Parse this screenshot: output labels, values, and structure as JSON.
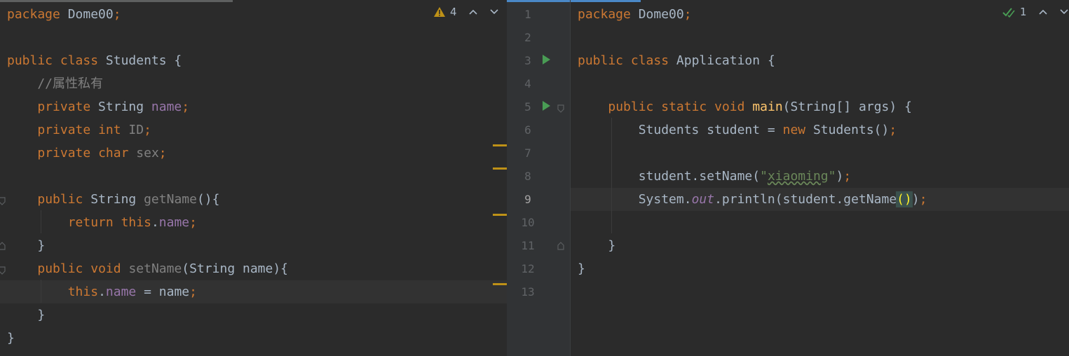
{
  "left_editor": {
    "lines": [
      [
        {
          "t": "package",
          "c": "kw"
        },
        {
          "t": " Dome00",
          "c": ""
        },
        {
          "t": ";",
          "c": "kw"
        }
      ],
      [],
      [
        {
          "t": "public",
          "c": "kw"
        },
        {
          "t": " ",
          "c": ""
        },
        {
          "t": "class",
          "c": "kw"
        },
        {
          "t": " Students {",
          "c": ""
        }
      ],
      [
        {
          "t": "    //属性私有",
          "c": "cmt"
        }
      ],
      [
        {
          "t": "    ",
          "c": ""
        },
        {
          "t": "private",
          "c": "kw"
        },
        {
          "t": " String ",
          "c": ""
        },
        {
          "t": "name",
          "c": "fld"
        },
        {
          "t": ";",
          "c": "kw"
        }
      ],
      [
        {
          "t": "    ",
          "c": ""
        },
        {
          "t": "private",
          "c": "kw"
        },
        {
          "t": " ",
          "c": ""
        },
        {
          "t": "int",
          "c": "kw"
        },
        {
          "t": " ",
          "c": ""
        },
        {
          "t": "ID",
          "c": "unused"
        },
        {
          "t": ";",
          "c": "kw"
        }
      ],
      [
        {
          "t": "    ",
          "c": ""
        },
        {
          "t": "private",
          "c": "kw"
        },
        {
          "t": " ",
          "c": ""
        },
        {
          "t": "char",
          "c": "kw"
        },
        {
          "t": " ",
          "c": ""
        },
        {
          "t": "sex",
          "c": "unused"
        },
        {
          "t": ";",
          "c": "kw"
        }
      ],
      [],
      [
        {
          "t": "    ",
          "c": ""
        },
        {
          "t": "public",
          "c": "kw"
        },
        {
          "t": " String ",
          "c": ""
        },
        {
          "t": "getName",
          "c": "unused"
        },
        {
          "t": "(){",
          "c": ""
        }
      ],
      [
        {
          "t": "        ",
          "c": ""
        },
        {
          "t": "return",
          "c": "kw"
        },
        {
          "t": " ",
          "c": ""
        },
        {
          "t": "this",
          "c": "kw"
        },
        {
          "t": ".",
          "c": ""
        },
        {
          "t": "name",
          "c": "fld"
        },
        {
          "t": ";",
          "c": "kw"
        }
      ],
      [
        {
          "t": "    }",
          "c": ""
        }
      ],
      [
        {
          "t": "    ",
          "c": ""
        },
        {
          "t": "public",
          "c": "kw"
        },
        {
          "t": " ",
          "c": ""
        },
        {
          "t": "void",
          "c": "kw"
        },
        {
          "t": " ",
          "c": ""
        },
        {
          "t": "setName",
          "c": "unused"
        },
        {
          "t": "(String name){",
          "c": ""
        }
      ],
      [
        {
          "t": "        ",
          "c": ""
        },
        {
          "t": "this",
          "c": "kw"
        },
        {
          "t": ".",
          "c": ""
        },
        {
          "t": "name",
          "c": "fld"
        },
        {
          "t": " = name",
          "c": ""
        },
        {
          "t": ";",
          "c": "kw"
        }
      ],
      [
        {
          "t": "    }",
          "c": ""
        }
      ],
      [
        {
          "t": "}",
          "c": ""
        }
      ]
    ],
    "current_line": 12,
    "inspection": {
      "icon": "warning-triangle-icon",
      "count": "4",
      "color": "#be9117"
    }
  },
  "gutter": {
    "line_numbers": [
      "1",
      "2",
      "3",
      "4",
      "5",
      "6",
      "7",
      "8",
      "9",
      "10",
      "11",
      "12",
      "13"
    ],
    "current_line": 8,
    "run_icons": [
      "run-class-icon",
      "run-main-icon"
    ],
    "run_color": "#499c54"
  },
  "right_editor": {
    "lines": [
      [
        {
          "t": "package",
          "c": "kw"
        },
        {
          "t": " Dome00",
          "c": ""
        },
        {
          "t": ";",
          "c": "kw"
        }
      ],
      [],
      [
        {
          "t": "public",
          "c": "kw"
        },
        {
          "t": " ",
          "c": ""
        },
        {
          "t": "class",
          "c": "kw"
        },
        {
          "t": " Application {",
          "c": ""
        }
      ],
      [],
      [
        {
          "t": "    ",
          "c": ""
        },
        {
          "t": "public",
          "c": "kw"
        },
        {
          "t": " ",
          "c": ""
        },
        {
          "t": "static",
          "c": "kw"
        },
        {
          "t": " ",
          "c": ""
        },
        {
          "t": "void",
          "c": "kw"
        },
        {
          "t": " ",
          "c": ""
        },
        {
          "t": "main",
          "c": "fn"
        },
        {
          "t": "(String[] args) {",
          "c": ""
        }
      ],
      [
        {
          "t": "        Students student = ",
          "c": ""
        },
        {
          "t": "new",
          "c": "kw"
        },
        {
          "t": " Students()",
          "c": ""
        },
        {
          "t": ";",
          "c": "kw"
        }
      ],
      [],
      [
        {
          "t": "        student.setName(",
          "c": ""
        },
        {
          "t": "\"",
          "c": "str"
        },
        {
          "t": "xiaoming",
          "c": "str typo"
        },
        {
          "t": "\"",
          "c": "str"
        },
        {
          "t": ")",
          "c": ""
        },
        {
          "t": ";",
          "c": "kw"
        }
      ],
      [
        {
          "t": "        System.",
          "c": ""
        },
        {
          "t": "out",
          "c": "static-fld"
        },
        {
          "t": ".println(student.getName",
          "c": ""
        },
        {
          "t": "()",
          "c": "brace-match"
        },
        {
          "t": ")",
          "c": ""
        },
        {
          "t": ";",
          "c": "kw"
        }
      ],
      [],
      [
        {
          "t": "    }",
          "c": ""
        }
      ],
      [
        {
          "t": "}",
          "c": ""
        }
      ],
      []
    ],
    "current_line": 8,
    "inspection": {
      "icon": "check-icon",
      "count": "1",
      "color": "#499c54"
    }
  },
  "colors": {
    "background": "#2b2b2b",
    "gutter": "#313335",
    "keyword": "#cc7832",
    "field": "#9876aa",
    "unused": "#808080",
    "string": "#6a8759",
    "method_decl": "#ffc66d",
    "warning_marker": "#be9117",
    "tab_indicator_left": "#5e6060",
    "tab_indicator_right": "#4a88c7"
  }
}
